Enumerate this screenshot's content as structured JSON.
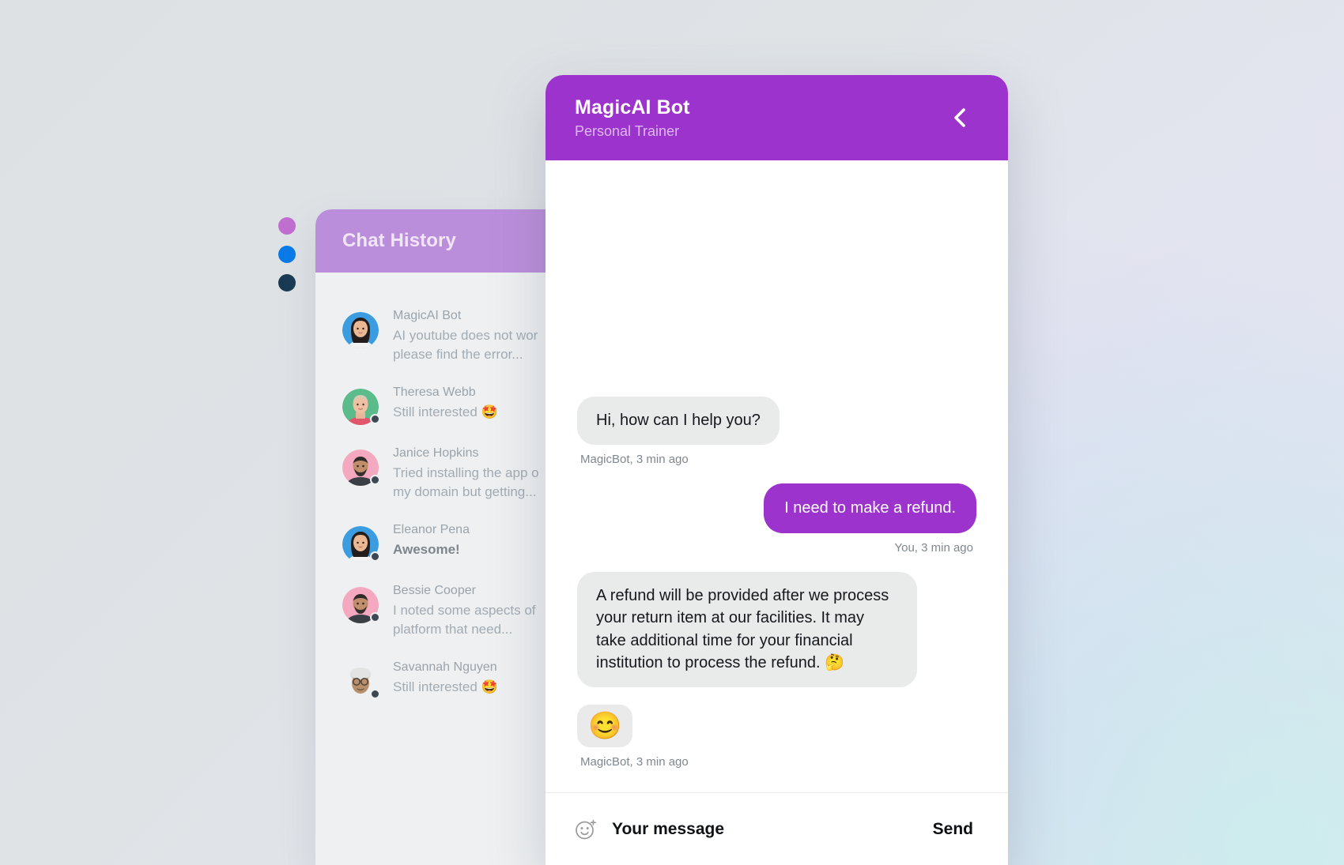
{
  "background": {
    "gradient_from": "#dde1e4",
    "gradient_to": "#e6eef0"
  },
  "status_dots": [
    {
      "name": "dot-orchid",
      "color": "#c06ed0"
    },
    {
      "name": "dot-blue",
      "color": "#0a7ae8"
    },
    {
      "name": "dot-navy",
      "color": "#1a3a53"
    }
  ],
  "chat_history": {
    "title": "Chat History",
    "header_color": "#bb8edb",
    "items": [
      {
        "name": "MagicAI Bot",
        "preview": "AI youtube does not wor\nplease find the error...",
        "unread": false,
        "avatar": "avatar-woman-blue",
        "avatar_bg": "#3b9de0",
        "online": false
      },
      {
        "name": "Theresa Webb",
        "preview": "Still interested 🤩",
        "unread": false,
        "avatar": "avatar-woman-green",
        "avatar_bg": "#5bbb8a",
        "online": true
      },
      {
        "name": "Janice Hopkins",
        "preview": "Tried installing the app o\nmy domain but getting...",
        "unread": false,
        "avatar": "avatar-man-pink",
        "avatar_bg": "#f4a9c0",
        "online": true
      },
      {
        "name": "Eleanor Pena",
        "preview": "Awesome!",
        "unread": true,
        "avatar": "avatar-woman-blue",
        "avatar_bg": "#3b9de0",
        "online": true
      },
      {
        "name": "Bessie Cooper",
        "preview": "I noted some aspects of\nplatform that need...",
        "unread": false,
        "avatar": "avatar-man-pink",
        "avatar_bg": "#f4a9c0",
        "online": true
      },
      {
        "name": "Savannah Nguyen",
        "preview": "Still interested 🤩",
        "unread": false,
        "avatar": "avatar-elder-glasses",
        "avatar_bg": "transparent",
        "online": true
      }
    ]
  },
  "chat_window": {
    "header": {
      "title": "MagicAI Bot",
      "subtitle": "Personal Trainer",
      "color": "#9b33cc",
      "back_icon": "chevron-left-icon"
    },
    "messages": [
      {
        "sender": "bot",
        "type": "text",
        "text": "Hi, how can I help you?",
        "meta": "MagicBot, 3 min ago"
      },
      {
        "sender": "user",
        "type": "text",
        "text": "I need to make a refund.",
        "meta": "You, 3 min ago"
      },
      {
        "sender": "bot",
        "type": "text",
        "text": "A refund will be provided after we process your return item at our facilities. It may take additional time for your financial institution to process the refund. 🤔",
        "meta": ""
      },
      {
        "sender": "bot",
        "type": "emoji",
        "text": "😊",
        "meta": "MagicBot, 3 min ago"
      }
    ],
    "composer": {
      "emoji_icon": "add-emoji-icon",
      "input_value": "",
      "input_placeholder": "Your message",
      "send_label": "Send"
    }
  }
}
